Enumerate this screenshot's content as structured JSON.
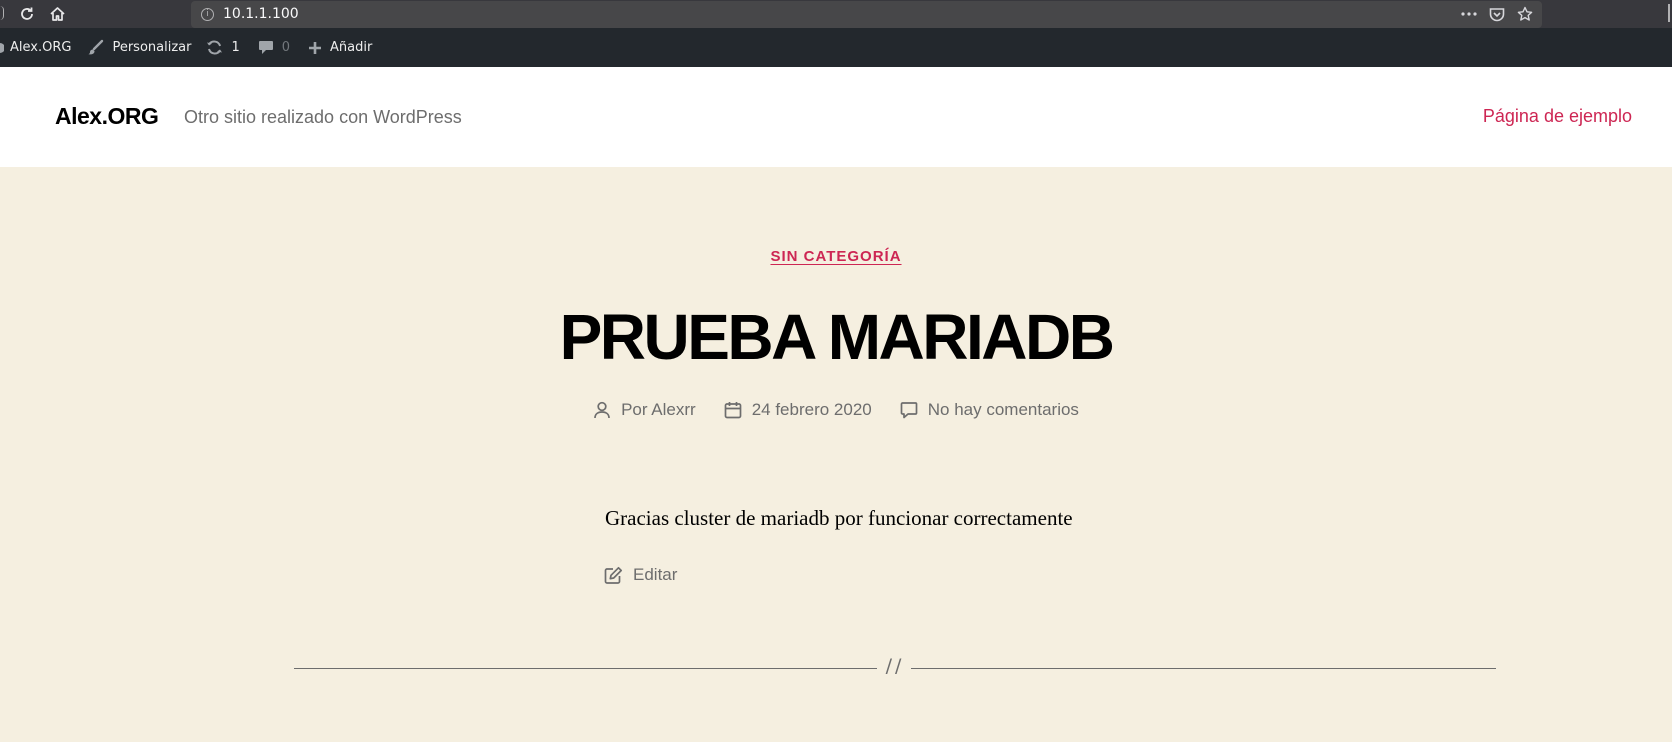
{
  "browser": {
    "url": "10.1.1.100",
    "icons": [
      "reload-icon",
      "home-icon",
      "info-icon",
      "more-icon",
      "pocket-icon",
      "bookmark-star-icon"
    ]
  },
  "admin_bar": {
    "site_name": "Alex.ORG",
    "customize": "Personalizar",
    "updates_count": "1",
    "comments_count": "0",
    "add_new": "Añadir"
  },
  "header": {
    "site_title": "Alex.ORG",
    "description": "Otro sitio realizado con WordPress",
    "nav_link": "Página de ejemplo"
  },
  "post": {
    "category": "SIN CATEGORÍA",
    "title": "PRUEBA MARIADB",
    "author": "Por Alexrr",
    "date": "24 febrero 2020",
    "comments": "No hay comentarios",
    "content": "Gracias cluster de mariadb por funcionar correctamente",
    "edit": "Editar",
    "separator": "//"
  },
  "colors": {
    "accent": "#cd2653",
    "background": "#f5efe0",
    "admin_bar": "#23282d",
    "browser_chrome": "#38383d",
    "meta_text": "#6d6d6d"
  }
}
